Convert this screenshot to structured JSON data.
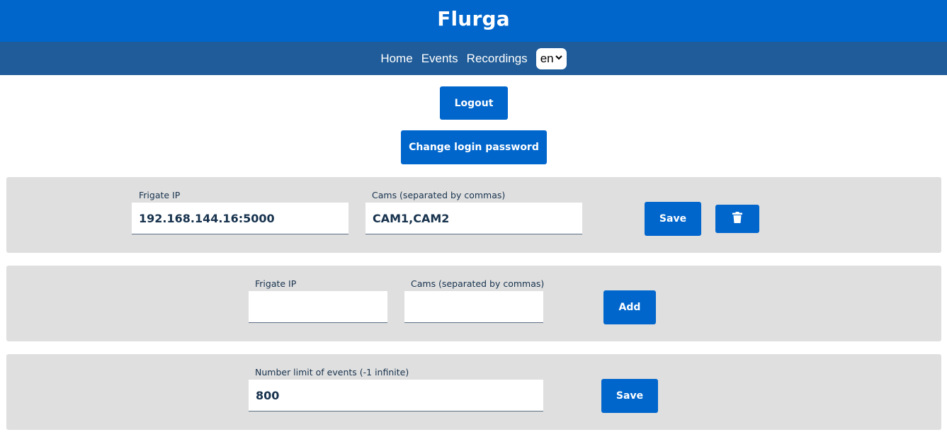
{
  "header": {
    "title": "Flurga"
  },
  "nav": {
    "items": [
      {
        "label": "Home"
      },
      {
        "label": "Events"
      },
      {
        "label": "Recordings"
      }
    ],
    "language": "en"
  },
  "account": {
    "logout_label": "Logout",
    "change_password_label": "Change login password"
  },
  "server_entry": {
    "ip_label": "Frigate IP",
    "ip_value": "192.168.144.16:5000",
    "cams_label": "Cams (separated by commas)",
    "cams_value": "CAM1,CAM2",
    "save_label": "Save",
    "delete_icon": "trash-icon"
  },
  "new_server": {
    "ip_label": "Frigate IP",
    "ip_value": "",
    "cams_label": "Cams (separated by commas)",
    "cams_value": "",
    "add_label": "Add"
  },
  "events_limit": {
    "label": "Number limit of events (-1 infinite)",
    "value": "800",
    "save_label": "Save"
  },
  "colors": {
    "primary": "#0066cc",
    "nav_bg": "#1f5c99",
    "panel_bg": "#dfdfdf",
    "text": "#17324d"
  }
}
